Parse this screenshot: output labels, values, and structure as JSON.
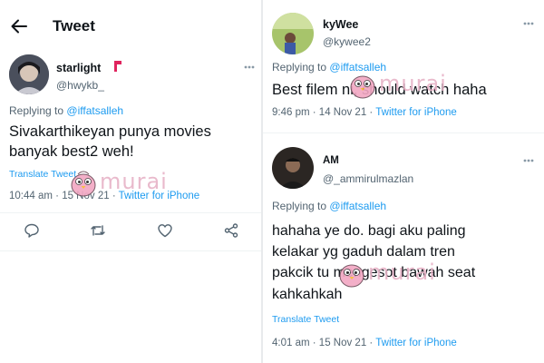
{
  "left": {
    "header_title": "Tweet",
    "tweet": {
      "author_name": "starlight",
      "author_handle": "@hwykb_",
      "replying_prefix": "Replying to",
      "replying_to": "@iffatsalleh",
      "text_line1": "Sivakarthikeyan punya movies",
      "text_line2": "banyak best2 weh!",
      "translate_label": "Translate Tweet",
      "time": "10:44 am",
      "date": "15 Nov 21",
      "source": "Twitter for iPhone"
    }
  },
  "right": {
    "tweet1": {
      "author_name": "kyWee",
      "author_handle": "@kywee2",
      "replying_prefix": "Replying to",
      "replying_to": "@iffatsalleh",
      "text": "Best filem ni, should watch haha",
      "time": "9:46 pm",
      "date": "14 Nov 21",
      "source": "Twitter for iPhone"
    },
    "tweet2": {
      "author_name": "AM",
      "author_handle": "@_ammirulmazlan",
      "replying_prefix": "Replying to",
      "replying_to": "@iffatsalleh",
      "text_line1": "hahaha ye do. bagi aku paling",
      "text_line2": "kelakar yg gaduh dalam tren",
      "text_line3": "pakcik tu mengesot bawah seat",
      "text_line4": "kahkahkah",
      "translate_label": "Translate Tweet",
      "time": "4:01 am",
      "date": "15 Nov 21",
      "source": "Twitter for iPhone"
    }
  },
  "watermark": {
    "text": "murai"
  },
  "colors": {
    "link": "#1d9bf0",
    "secondary": "#536471",
    "text": "#0f1419",
    "watermark": "#e7b3c7"
  },
  "icons": [
    "back-arrow-icon",
    "more-icon",
    "reply-icon",
    "retweet-icon",
    "like-icon",
    "share-icon",
    "verified-flag-icon"
  ]
}
